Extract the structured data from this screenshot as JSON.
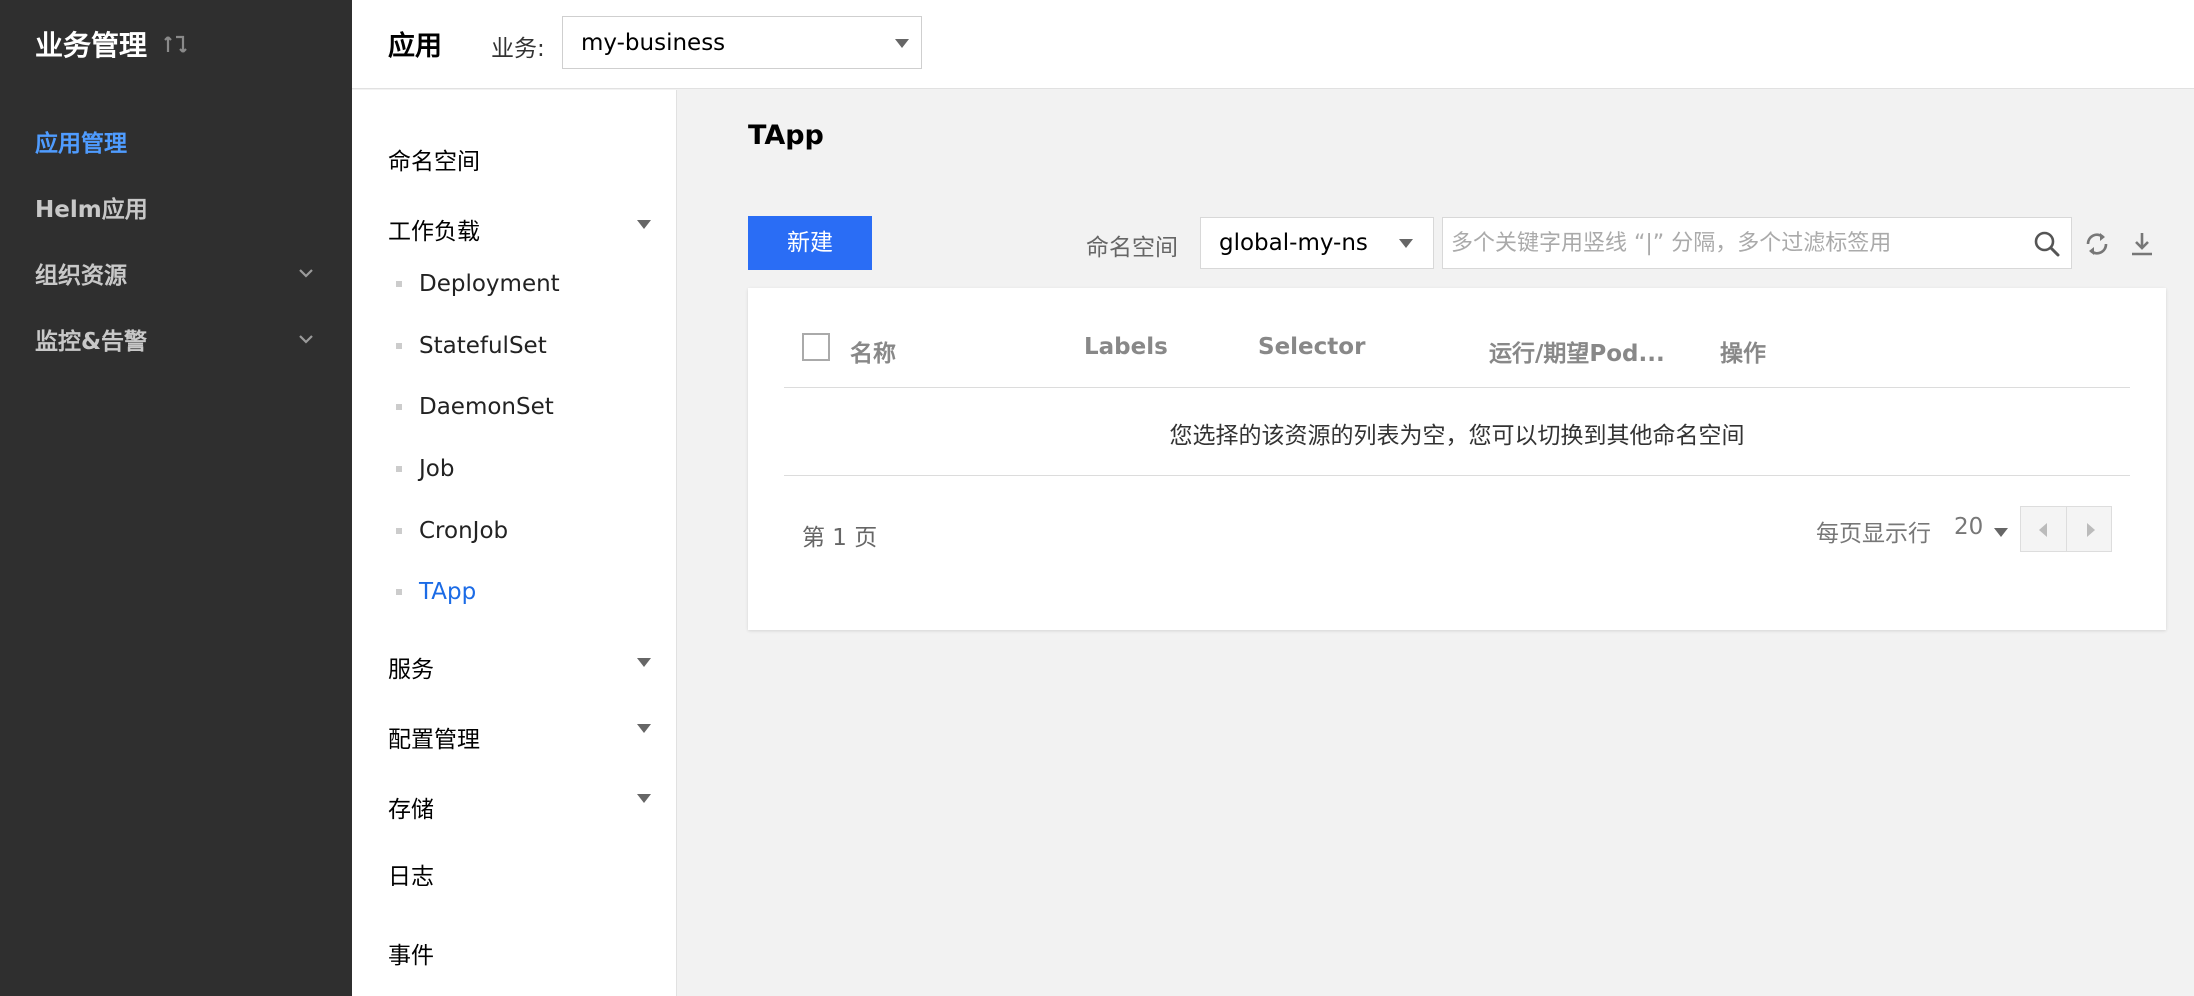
{
  "sidebar": {
    "title": "业务管理",
    "items": [
      {
        "label": "应用管理",
        "active": true
      },
      {
        "label": "Helm应用"
      },
      {
        "label": "组织资源",
        "expandable": true
      },
      {
        "label": "监控&告警",
        "expandable": true
      }
    ]
  },
  "topbar": {
    "title": "应用",
    "business_label": "业务:",
    "business_value": "my-business"
  },
  "subnav": {
    "items": [
      {
        "label": "命名空间"
      },
      {
        "label": "工作负载",
        "expandable": true
      },
      {
        "label": "服务",
        "expandable": true
      },
      {
        "label": "配置管理",
        "expandable": true
      },
      {
        "label": "存储",
        "expandable": true
      },
      {
        "label": "日志"
      },
      {
        "label": "事件"
      }
    ],
    "workload_items": [
      {
        "label": "Deployment"
      },
      {
        "label": "StatefulSet"
      },
      {
        "label": "DaemonSet"
      },
      {
        "label": "Job"
      },
      {
        "label": "CronJob"
      },
      {
        "label": "TApp",
        "active": true
      }
    ]
  },
  "main": {
    "title": "TApp",
    "new_button": "新建",
    "namespace_label": "命名空间",
    "namespace_value": "global-my-ns",
    "search_placeholder": "多个关键字用竖线 “|” 分隔，多个过滤标签用",
    "table": {
      "columns": [
        "名称",
        "Labels",
        "Selector",
        "运行/期望Pod...",
        "操作"
      ],
      "empty_message": "您选择的该资源的列表为空，您可以切换到其他命名空间"
    },
    "pagination": {
      "page_text": "第 1 页",
      "page_size_label": "每页显示行",
      "page_size": "20"
    }
  },
  "colors": {
    "sidebar_bg": "#2f2f2f",
    "sidebar_active": "#4f9cff",
    "primary_button": "#2a6df5",
    "subnav_active": "#1b6be6"
  }
}
